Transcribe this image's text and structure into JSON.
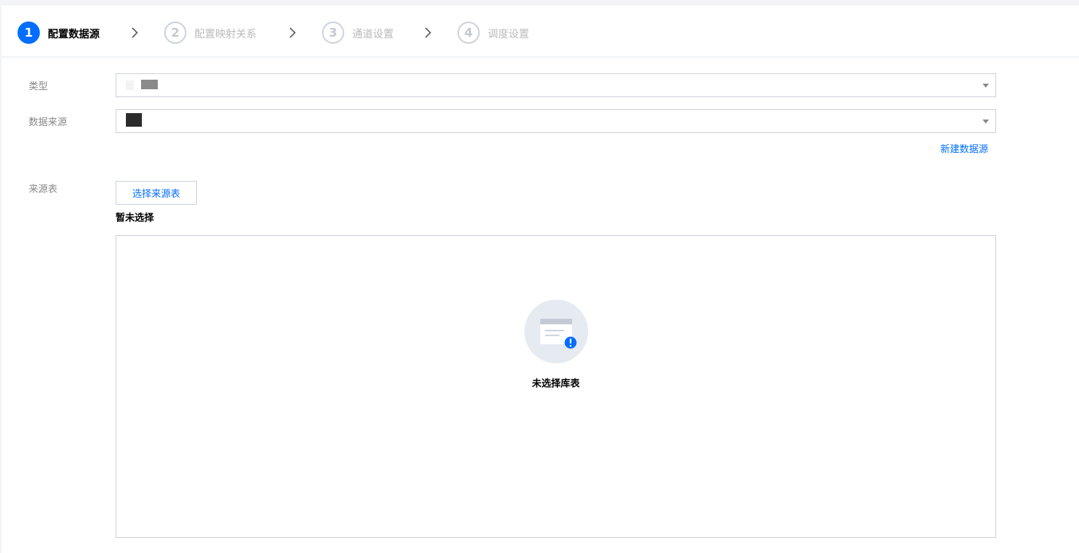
{
  "steps": [
    {
      "num": "1",
      "label": "配置数据源",
      "active": true
    },
    {
      "num": "2",
      "label": "配置映射关系",
      "active": false
    },
    {
      "num": "3",
      "label": "通道设置",
      "active": false
    },
    {
      "num": "4",
      "label": "调度设置",
      "active": false
    }
  ],
  "form": {
    "type_label": "类型",
    "source_label": "数据来源",
    "new_source_link": "新建数据源",
    "table_label": "来源表",
    "select_table_button": "选择来源表",
    "selection_status": "暂未选择"
  },
  "empty_state": {
    "icon": "empty-table-icon",
    "text": "未选择库表"
  },
  "colors": {
    "accent": "#006eff",
    "border": "#d0d4db",
    "muted_text": "#888888"
  }
}
